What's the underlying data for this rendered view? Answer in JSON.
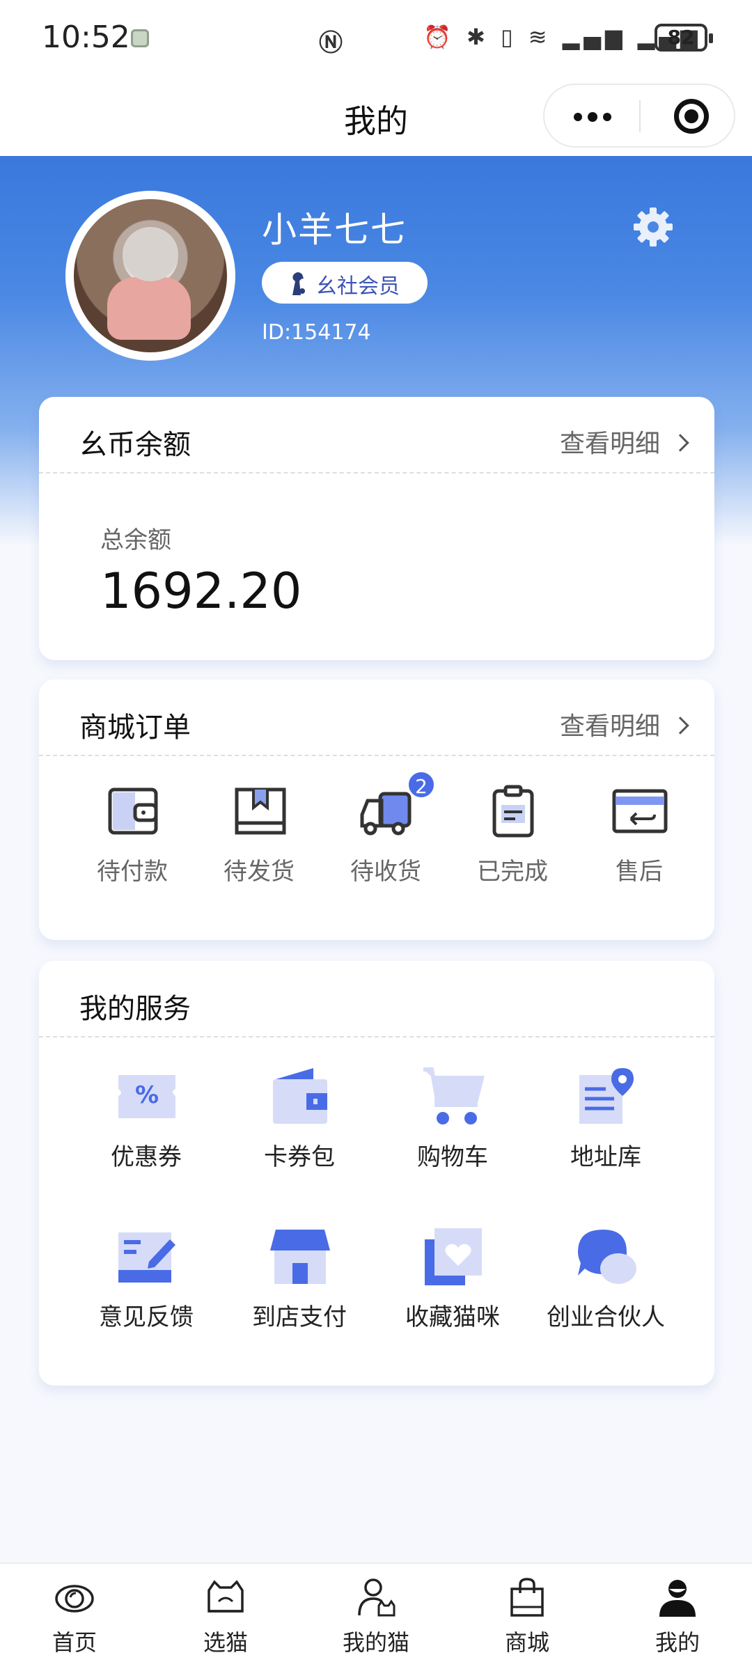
{
  "status_bar": {
    "time": "10:52",
    "battery": "82"
  },
  "title_bar": {
    "title": "我的"
  },
  "profile": {
    "name": "小羊七七",
    "member_label": "幺社会员",
    "id": "ID:154174"
  },
  "balance": {
    "title": "幺币余额",
    "link": "查看明细",
    "label": "总余额",
    "value": "1692.20"
  },
  "orders": {
    "title": "商城订单",
    "link": "查看明细",
    "items": [
      {
        "label": "待付款",
        "icon": "wallet-icon"
      },
      {
        "label": "待发货",
        "icon": "box-icon"
      },
      {
        "label": "待收货",
        "icon": "truck-icon",
        "badge": "2"
      },
      {
        "label": "已完成",
        "icon": "clipboard-icon"
      },
      {
        "label": "售后",
        "icon": "return-card-icon"
      }
    ]
  },
  "services": {
    "title": "我的服务",
    "items": [
      {
        "label": "优惠券",
        "icon": "coupon-icon"
      },
      {
        "label": "卡券包",
        "icon": "card-wallet-icon"
      },
      {
        "label": "购物车",
        "icon": "cart-icon"
      },
      {
        "label": "地址库",
        "icon": "address-icon"
      },
      {
        "label": "意见反馈",
        "icon": "feedback-icon"
      },
      {
        "label": "到店支付",
        "icon": "store-icon"
      },
      {
        "label": "收藏猫咪",
        "icon": "favorite-icon"
      },
      {
        "label": "创业合伙人",
        "icon": "chat-bubble-icon"
      }
    ]
  },
  "bottom_nav": [
    {
      "label": "首页",
      "icon": "eye-icon"
    },
    {
      "label": "选猫",
      "icon": "cat-icon"
    },
    {
      "label": "我的猫",
      "icon": "person-cat-icon"
    },
    {
      "label": "商城",
      "icon": "bag-icon"
    },
    {
      "label": "我的",
      "icon": "user-icon",
      "active": true
    }
  ],
  "colors": {
    "accent": "#4a6be6",
    "hero_top": "#3a78dc",
    "icon_light": "#d6dcf7"
  }
}
